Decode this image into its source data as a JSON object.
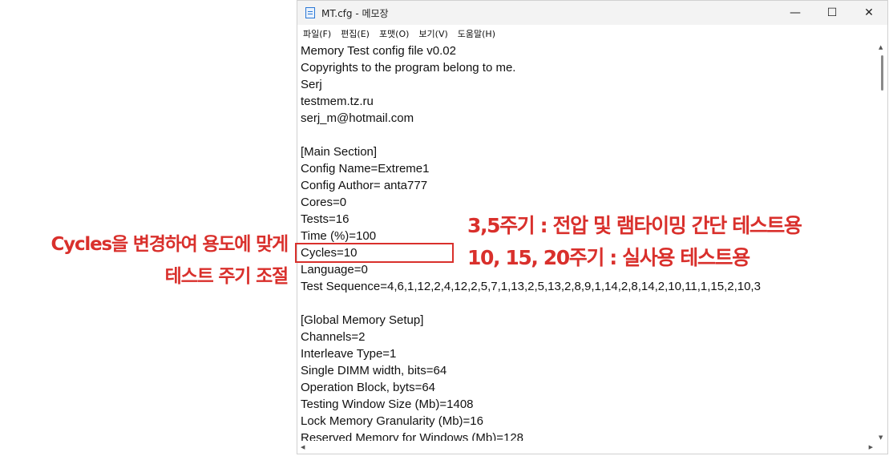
{
  "window": {
    "title": "MT.cfg - 메모장",
    "controls": {
      "minimize": "—",
      "maximize": "☐",
      "close": "✕"
    },
    "icon": "notepad-icon"
  },
  "menu": [
    "파일(F)",
    "편집(E)",
    "포맷(O)",
    "보기(V)",
    "도움말(H)"
  ],
  "editor": {
    "lines": [
      "Memory Test config file v0.02",
      "Copyrights to the program belong to me.",
      "Serj",
      "testmem.tz.ru",
      "serj_m@hotmail.com",
      "",
      "[Main Section]",
      "Config Name=Extreme1",
      "Config Author= anta777",
      "Cores=0",
      "Tests=16",
      "Time (%)=100",
      "Cycles=10",
      "Language=0",
      "Test Sequence=4,6,1,12,2,4,12,2,5,7,1,13,2,5,13,2,8,9,1,14,2,8,14,2,10,11,1,15,2,10,3",
      "",
      "[Global Memory Setup]",
      "Channels=2",
      "Interleave Type=1",
      "Single DIMM width, bits=64",
      "Operation Block, byts=64",
      "Testing Window Size (Mb)=1408",
      "Lock Memory Granularity (Mb)=16",
      "Reserved Memory for Windows (Mb)=128"
    ]
  },
  "annotations": {
    "left_line1": "Cycles을 변경하여 용도에 맞게",
    "left_line2": "테스트 주기 조절",
    "right_line1": "3,5주기 : 전압 및 램타이밍 간단 테스트용",
    "right_line2": "10, 15, 20주기 : 실사용 테스트용",
    "accent_color": "#d9302c"
  }
}
